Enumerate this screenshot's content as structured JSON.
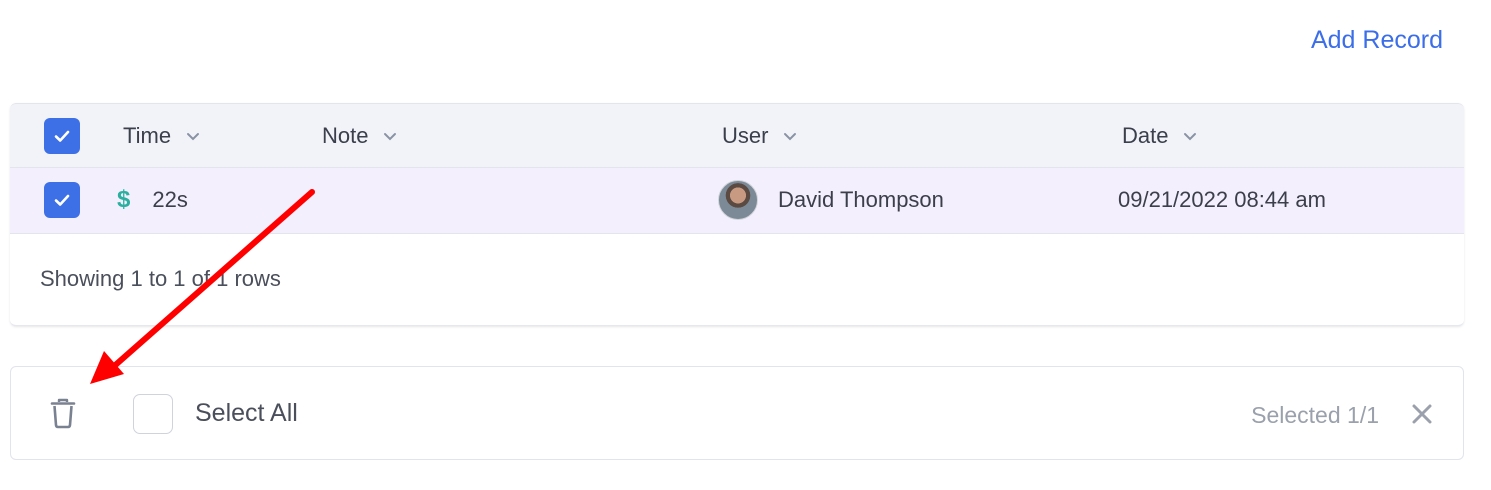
{
  "toolbar": {
    "add_record_label": "Add Record"
  },
  "table": {
    "columns": [
      {
        "label": "Time"
      },
      {
        "label": "Note"
      },
      {
        "label": "User"
      },
      {
        "label": "Date"
      }
    ],
    "rows": [
      {
        "selected": true,
        "icon": "dollar-icon",
        "currency_symbol": "$",
        "time": "22s",
        "note": "",
        "user": "David Thompson",
        "date": "09/21/2022 08:44 am"
      }
    ],
    "footer": "Showing 1 to 1 of 1 rows"
  },
  "bulk_actions": {
    "select_all_label": "Select All",
    "selected_count": "Selected 1/1"
  },
  "colors": {
    "accent": "#3b6ee8",
    "row_selected": "#f4effd",
    "header_bg": "#f2f3f8",
    "dollar": "#2bb0a0",
    "annotation_arrow": "#ff0000"
  }
}
